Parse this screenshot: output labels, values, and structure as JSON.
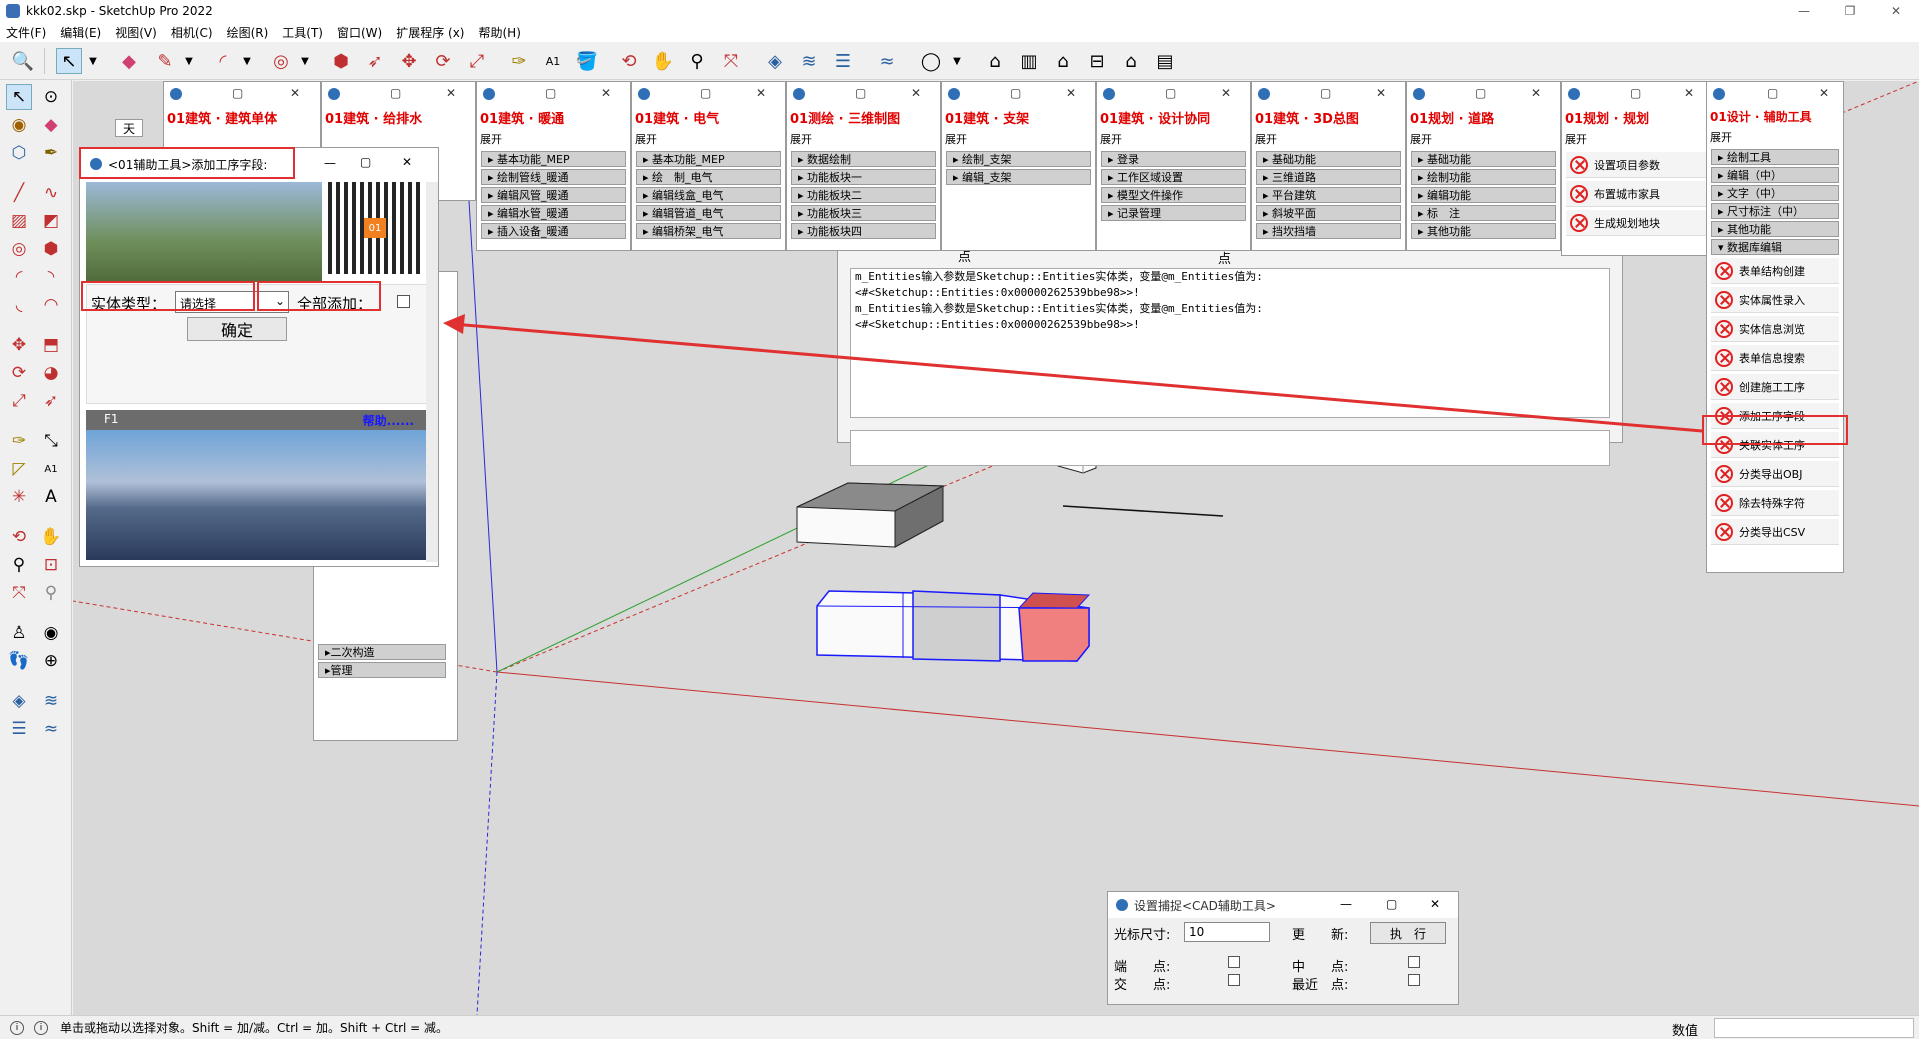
{
  "window": {
    "title": "kkk02.skp - SketchUp Pro 2022"
  },
  "menu": [
    "文件(F)",
    "编辑(E)",
    "视图(V)",
    "相机(C)",
    "绘图(R)",
    "工具(T)",
    "窗口(W)",
    "扩展程序 (x)",
    "帮助(H)"
  ],
  "toolbar_icons": [
    "zoom-icon",
    "select-icon",
    "eraser-icon",
    "pencil-icon",
    "arc-icon",
    "circle-icon",
    "pushpull-icon",
    "followme-icon",
    "move-icon",
    "rotate-icon",
    "scale-icon",
    "tape-icon",
    "text-icon",
    "paint-icon",
    "orbit-icon",
    "pan-icon",
    "zoom-window-icon",
    "zoom-extents-icon",
    "layers-icon",
    "styles-icon",
    "scenes-icon",
    "shadows-icon",
    "account-icon",
    "warehouse-icon",
    "extension-icon",
    "home-icon",
    "component-icon",
    "house-icon",
    "building-icon"
  ],
  "panels": [
    {
      "title": "01建筑 · 建筑单体",
      "items": []
    },
    {
      "title": "01建筑 · 给排水",
      "items": []
    },
    {
      "title": "01建筑 · 暖通",
      "expand": "展开",
      "items": [
        "基本功能_MEP",
        "绘制管线_暖通",
        "编辑风管_暖通",
        "编辑水管_暖通",
        "插入设备_暖通"
      ]
    },
    {
      "title": "01建筑 · 电气",
      "expand": "展开",
      "items": [
        "基本功能_MEP",
        "绘　制_电气",
        "编辑线盒_电气",
        "编辑管道_电气",
        "编辑桥架_电气"
      ]
    },
    {
      "title": "01测绘 · 三维制图",
      "expand": "展开",
      "items": [
        "数据绘制",
        "功能板块一",
        "功能板块二",
        "功能板块三",
        "功能板块四"
      ]
    },
    {
      "title": "01建筑 · 支架",
      "expand": "展开",
      "items": [
        "绘制_支架",
        "编辑_支架"
      ]
    },
    {
      "title": "01建筑 · 设计协同",
      "expand": "展开",
      "items": [
        "登录",
        "工作区域设置",
        "模型文件操作",
        "记录管理"
      ]
    },
    {
      "title": "01建筑 · 3D总图",
      "expand": "展开",
      "items": [
        "基础功能",
        "三维道路",
        "平台建筑",
        "斜坡平面",
        "挡坎挡墙"
      ]
    },
    {
      "title": "01规划 · 道路",
      "expand": "展开",
      "items": [
        "基础功能",
        "绘制功能",
        "编辑功能",
        "标　注",
        "其他功能"
      ]
    },
    {
      "title": "01规划 · 规划",
      "expand": "展开",
      "items": [
        "设置项目参数",
        "布置城市家具",
        "生成规划地块"
      ]
    }
  ],
  "right_panel": {
    "title": "01设计 · 辅助工具",
    "expand": "展开",
    "groups": [
      "绘制工具",
      "编辑（中）",
      "文字（中）",
      "尺寸标注（中）",
      "其他功能",
      "数据库编辑"
    ],
    "buttons": [
      "表单结构创建",
      "实体属性录入",
      "实体信息浏览",
      "表单信息搜索",
      "创建施工工序",
      "添加工序字段",
      "关联实体工序",
      "分类导出OBJ",
      "除去特殊字符",
      "分类导出CSV"
    ]
  },
  "dialog": {
    "title": "<01辅助工具>添加工序字段:",
    "entity_type_label": "实体类型：",
    "entity_type_value": "请选择",
    "add_all_label": "全部添加：",
    "confirm": "确定",
    "banner_label": "F1",
    "help": "帮助......"
  },
  "behind_panel": {
    "items": [
      "二次构造",
      "管理"
    ],
    "tab": "天"
  },
  "console": {
    "partial_top": "m_Entities输入参数是Sketchup::Entities实体类，变量@m_Entities值为:",
    "lines": [
      "<#<Sketchup::Entities:0x00000262539bbe98>>!",
      "m_Entities输入参数是Sketchup::Entities实体类，变量@m_Entities值为:",
      "<#<Sketchup::Entities:0x00000262539bbe98>>!"
    ],
    "fragment1": "点",
    "fragment2": "点"
  },
  "cad_dialog": {
    "title": "设置捕捉<CAD辅助工具>",
    "cursor_label": "光标尺寸:",
    "cursor_value": "10",
    "update_label": "更　　新:",
    "execute": "执　行",
    "endpoint": "端　　点:",
    "midpoint": "中　　点:",
    "intersection": "交　　点:",
    "nearest": "最近　点:"
  },
  "status": {
    "text": "单击或拖动以选择对象。Shift = 加/减。Ctrl = 加。Shift + Ctrl = 减。",
    "measure_label": "数值"
  },
  "colors": {
    "accent_red": "#e03030",
    "title_red": "#e00000",
    "help_blue": "#1a1aff",
    "selection_blue": "#1a1aff"
  }
}
